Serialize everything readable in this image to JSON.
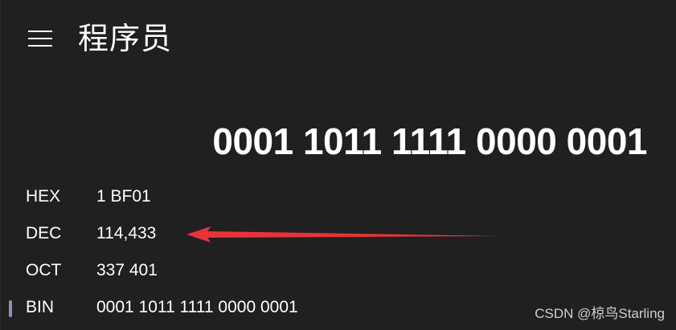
{
  "title_bar": {
    "mode_title": "程序员",
    "menu_icon": "hamburger-menu-icon"
  },
  "display": {
    "value": "0001 1011 1111 0000 0001"
  },
  "radix_rows": [
    {
      "label": "HEX",
      "value": "1 BF01"
    },
    {
      "label": "DEC",
      "value": "114,433"
    },
    {
      "label": "OCT",
      "value": "337 401"
    },
    {
      "label": "BIN",
      "value": "0001 1011 1111 0000 0001"
    }
  ],
  "selected_radix": "BIN",
  "annotation": {
    "arrow_color": "#e8333a",
    "points_to": "DEC"
  },
  "watermark": {
    "text": "CSDN @椋鸟Starling"
  },
  "colors": {
    "background": "#202020",
    "text": "#ffffff",
    "selection_indicator": "#8e8eb8"
  }
}
